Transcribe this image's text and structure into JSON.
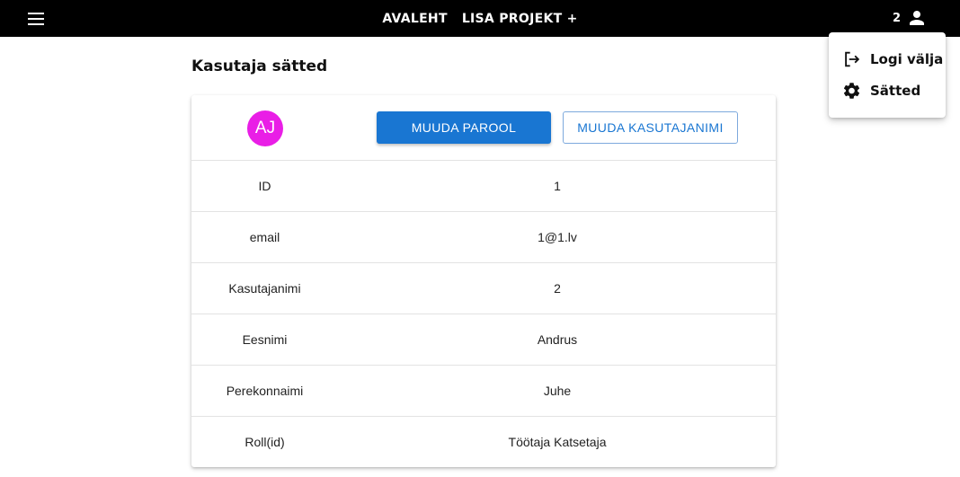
{
  "appbar": {
    "menu_icon": "menu-icon",
    "nav": [
      {
        "label": "AVALEHT"
      },
      {
        "label": "LISA PROJEKT +"
      }
    ],
    "user_id": "2",
    "user_icon": "person-icon"
  },
  "user_menu": {
    "items": [
      {
        "label": "Logi välja",
        "icon": "logout-icon"
      },
      {
        "label": "Sätted",
        "icon": "gear-icon"
      }
    ]
  },
  "page": {
    "title": "Kasutaja sätted"
  },
  "profile": {
    "avatar_initials": "AJ",
    "avatar_color": "#e91ee6",
    "change_password_label": "MUUDA PAROOL",
    "change_username_label": "MUUDA KASUTAJANIMI",
    "accent_color": "#1976d2",
    "fields": [
      {
        "label": "ID",
        "value": "1"
      },
      {
        "label": "email",
        "value": "1@1.lv"
      },
      {
        "label": "Kasutajanimi",
        "value": "2"
      },
      {
        "label": "Eesnimi",
        "value": "Andrus"
      },
      {
        "label": "Perekonnaimi",
        "value": "Juhe"
      },
      {
        "label": "Roll(id)",
        "value": "Töötaja Katsetaja"
      }
    ]
  }
}
